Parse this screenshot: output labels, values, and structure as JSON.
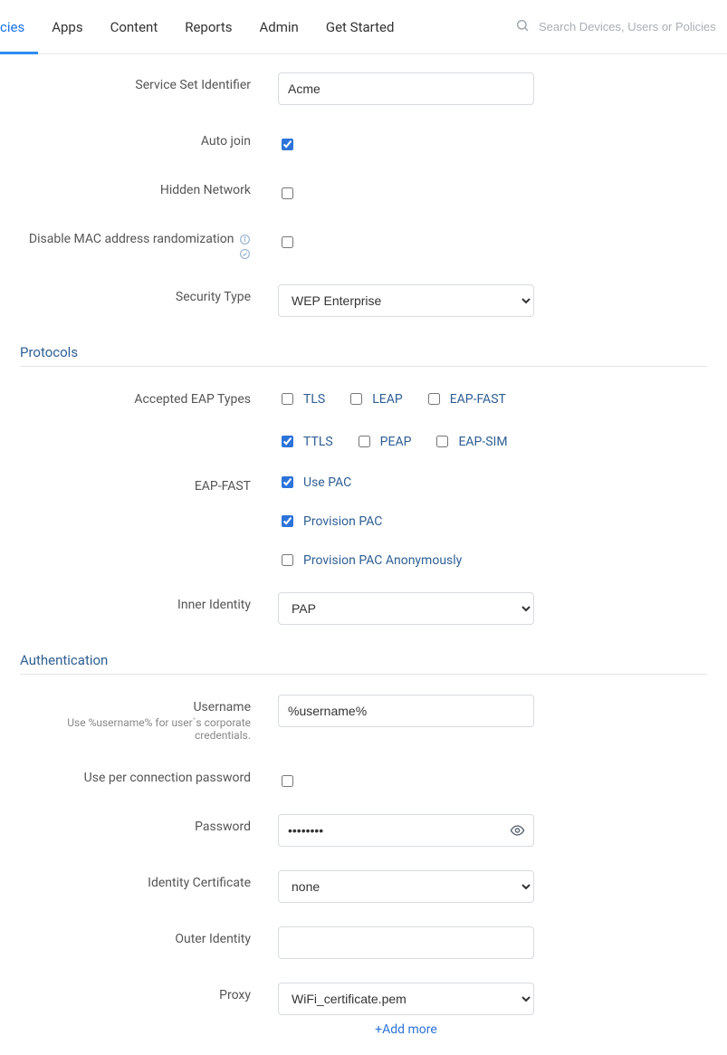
{
  "nav": {
    "items": [
      "cies",
      "Apps",
      "Content",
      "Reports",
      "Admin",
      "Get Started"
    ],
    "active_index": 0
  },
  "search": {
    "placeholder": "Search Devices, Users or Policies"
  },
  "form": {
    "ssid": {
      "label": "Service Set Identifier",
      "value": "Acme"
    },
    "auto_join": {
      "label": "Auto join",
      "checked": true
    },
    "hidden_network": {
      "label": "Hidden Network",
      "checked": false
    },
    "disable_mac": {
      "label": "Disable MAC address randomization",
      "checked": false
    },
    "security": {
      "label": "Security Type",
      "selected": "WEP Enterprise"
    }
  },
  "protocols": {
    "title": "Protocols",
    "accepted": {
      "label": "Accepted EAP Types",
      "row1": [
        {
          "label": "TLS",
          "checked": false
        },
        {
          "label": "LEAP",
          "checked": false
        },
        {
          "label": "EAP-FAST",
          "checked": false
        }
      ],
      "row2": [
        {
          "label": "TTLS",
          "checked": true
        },
        {
          "label": "PEAP",
          "checked": false
        },
        {
          "label": "EAP-SIM",
          "checked": false
        }
      ]
    },
    "eap_fast": {
      "label": "EAP-FAST",
      "options": [
        {
          "label": "Use PAC",
          "checked": true
        },
        {
          "label": "Provision PAC",
          "checked": true
        },
        {
          "label": "Provision PAC Anonymously",
          "checked": false
        }
      ]
    },
    "inner_identity": {
      "label": "Inner Identity",
      "selected": "PAP"
    }
  },
  "auth": {
    "title": "Authentication",
    "username": {
      "label": "Username",
      "hint": "Use %username% for user`s corporate credentials.",
      "value": "%username%"
    },
    "per_conn": {
      "label": "Use per connection password",
      "checked": false
    },
    "password": {
      "label": "Password",
      "value": "••••••••"
    },
    "identity_cert": {
      "label": "Identity Certificate",
      "selected": "none"
    },
    "outer_identity": {
      "label": "Outer Identity",
      "value": ""
    },
    "proxy": {
      "label": "Proxy",
      "selected": "WiFi_certificate.pem"
    },
    "add_more": "+Add more"
  }
}
